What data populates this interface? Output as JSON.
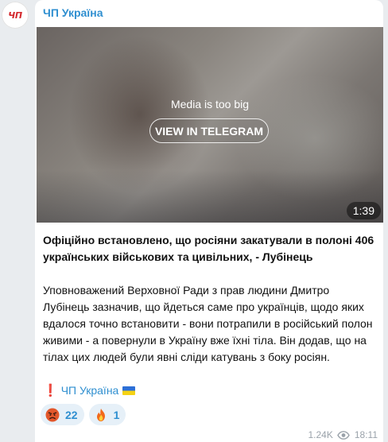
{
  "channel": {
    "avatar_text": "ЧП",
    "name": "ЧП Україна"
  },
  "media": {
    "notice": "Media is too big",
    "button_label": "VIEW IN TELEGRAM",
    "duration": "1:39"
  },
  "message": {
    "headline": "Офіційно встановлено, що росіяни закатували в полоні 406 українських військових та цивільних, - Лубінець",
    "body": "Уповноважений Верховної Ради з прав людини Дмитро Лубінець зазначив, що йдеться саме про українців, щодо яких вдалося точно встановити - вони потрапили в російський полон живими - а повернули в Україну вже їхні тіла. Він додав, що на тілах цих людей були явні сліди катувань з боку росіян.",
    "signature_link": "ЧП Україна",
    "signature_prefix_icon": "red-exclamation-icon",
    "signature_suffix_icon": "ukraine-flag-icon"
  },
  "reactions": [
    {
      "icon": "angry-face-icon",
      "count": "22"
    },
    {
      "icon": "fire-icon",
      "count": "1"
    }
  ],
  "meta": {
    "views": "1.24K",
    "time": "18:11",
    "views_icon": "eye-icon"
  },
  "colors": {
    "accent": "#2f8fd0",
    "avatar_text": "#d3262b",
    "background": "#e9ecef"
  }
}
